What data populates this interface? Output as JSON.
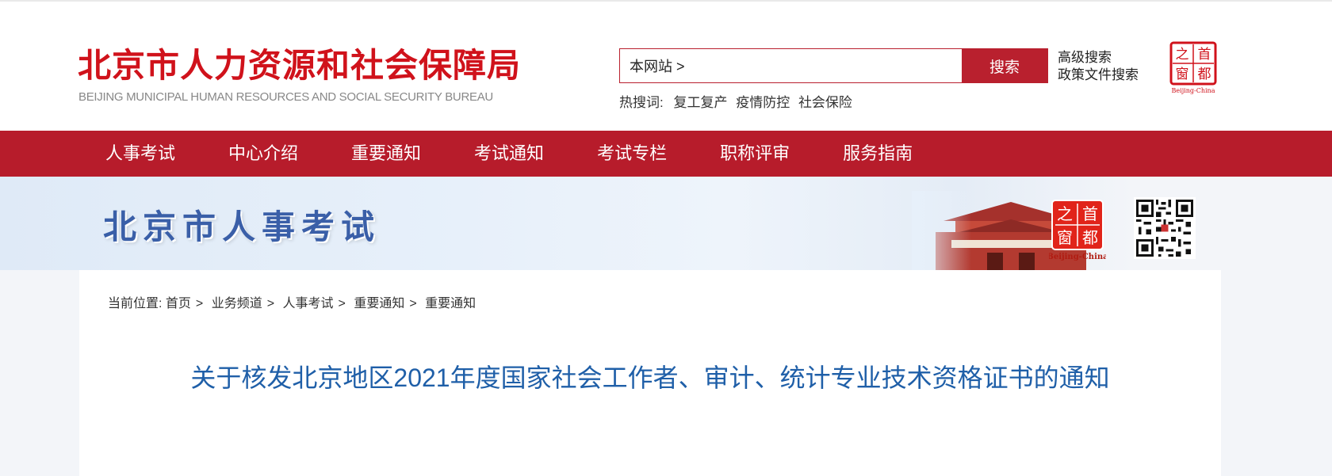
{
  "header": {
    "logo_cn": "北京市人力资源和社会保障局",
    "logo_en": "BEIJING MUNICIPAL HUMAN RESOURCES AND SOCIAL SECURITY BUREAU",
    "search": {
      "value": "本网站 >",
      "button": "搜索"
    },
    "advanced_search": "高级搜索",
    "policy_search": "政策文件搜索",
    "hot_label": "热搜词:",
    "hot_words": [
      "复工复产",
      "疫情防控",
      "社会保险"
    ],
    "seal": {
      "chars": [
        "之",
        "首",
        "窗",
        "都"
      ],
      "caption": "Beijing-China"
    }
  },
  "nav": [
    "人事考试",
    "中心介绍",
    "重要通知",
    "考试通知",
    "考试专栏",
    "职称评审",
    "服务指南"
  ],
  "banner": {
    "title": "北京市人事考试"
  },
  "breadcrumb": {
    "prefix": "当前位置:",
    "items": [
      "首页",
      "业务频道",
      "人事考试",
      "重要通知",
      "重要通知"
    ]
  },
  "article": {
    "title": "关于核发北京地区2021年度国家社会工作者、审计、统计专业技术资格证书的通知"
  },
  "colors": {
    "brand_red": "#b71c2b",
    "title_blue": "#1f5fa8",
    "banner_blue": "#3a5fa8"
  }
}
